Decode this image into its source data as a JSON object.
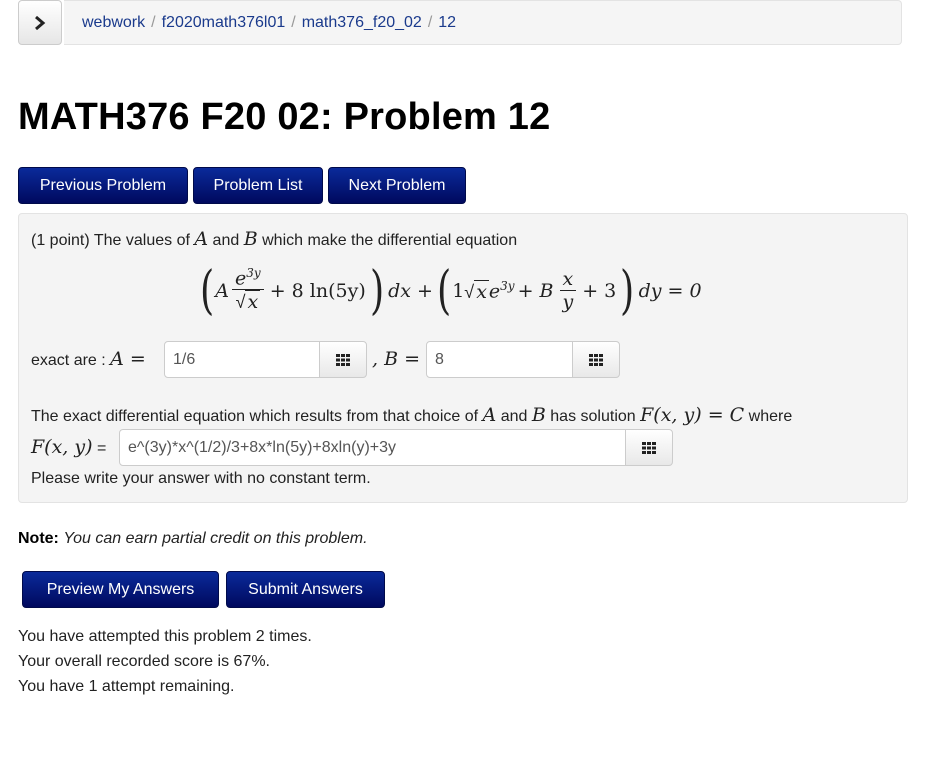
{
  "breadcrumb": {
    "toggle_icon": "chevron-right-icon",
    "items": [
      "webwork",
      "f2020math376l01",
      "math376_f20_02",
      "12"
    ],
    "separator": "/"
  },
  "page_title": "MATH376 F20 02: Problem 12",
  "nav_buttons": {
    "previous": "Previous Problem",
    "list": "Problem List",
    "next": "Next Problem"
  },
  "problem": {
    "intro_prefix": "(1 point) The values of",
    "var_A": "A",
    "and": "and",
    "var_B": "B",
    "intro_suffix": "which make the differential equation",
    "equation": {
      "term1_coef": "A",
      "term1_num": "e",
      "term1_num_exp": "3y",
      "term1_den": "x",
      "term1_rest": "+ 8 ln(5y)",
      "dx": "dx +",
      "term2_coef": "1",
      "term2_sqrt": "x",
      "term2_e": "e",
      "term2_exp": "3y",
      "term2_plus": "+ B",
      "term2_frac_num": "x",
      "term2_frac_den": "y",
      "term2_rest": "+ 3",
      "dy": "dy = 0"
    },
    "exact_are_label": "exact are :",
    "A_eq": "A =",
    "B_eq": ", B =",
    "answer_A": "1/6",
    "answer_B": "8",
    "solution_prefix": "The exact differential equation which results from that choice of",
    "solution_mid1": "and",
    "solution_mid2": "has solution",
    "solution_F": "F(x, y) = C",
    "solution_suffix": "where",
    "F_label": "F(x, y)",
    "F_eq": "=",
    "answer_F": "e^(3y)*x^(1/2)/3+8x*ln(5y)+8xln(y)+3y",
    "instruction": "Please write your answer with no constant term.",
    "equation_editor_icon": "grid-icon"
  },
  "note": {
    "label": "Note:",
    "text": "You can earn partial credit on this problem."
  },
  "action_buttons": {
    "preview": "Preview My Answers",
    "submit": "Submit Answers"
  },
  "status": {
    "attempts": "You have attempted this problem 2 times.",
    "score": "Your overall recorded score is 67%.",
    "remaining": "You have 1 attempt remaining."
  }
}
